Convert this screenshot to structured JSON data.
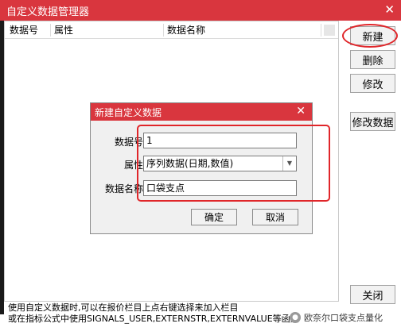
{
  "window": {
    "title": "自定义数据管理器",
    "close_glyph": "✕"
  },
  "list": {
    "columns": [
      "数据号",
      "属性",
      "数据名称"
    ]
  },
  "buttons": {
    "new": "新建",
    "delete": "删除",
    "edit": "修改",
    "edit_data": "修改数据",
    "close": "关闭"
  },
  "status": {
    "line1": "使用自定义数据时,可以在报价栏目上点右键选择来加入栏目",
    "line2": "或在指标公式中使用SIGNALS_USER,EXTERNSTR,EXTERNVALUE等函数"
  },
  "watermark": "欧奈尔口袋支点量化",
  "dialog": {
    "title": "新建自定义数据",
    "close_glyph": "✕",
    "id_label": "数据号:",
    "id_value": "1",
    "attr_label": "属性:",
    "attr_value": "序列数据(日期,数值)",
    "name_label": "数据名称:",
    "name_value": "口袋支点",
    "ok": "确定",
    "cancel": "取消"
  },
  "colors": {
    "titlebar": "#d9363e",
    "highlight": "#e0262a"
  }
}
